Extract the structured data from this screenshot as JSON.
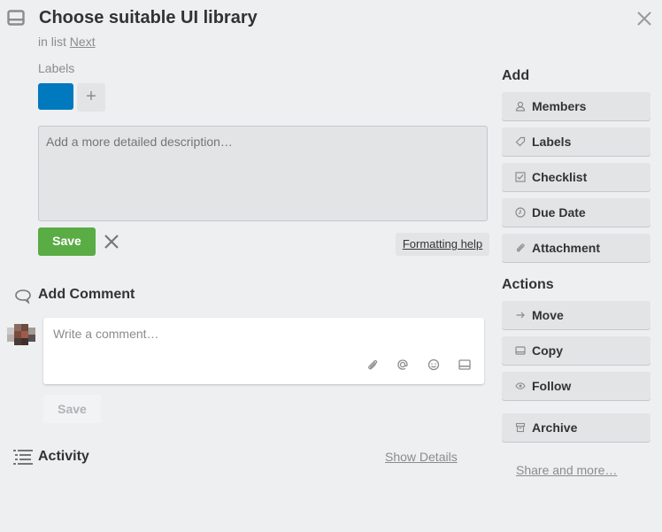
{
  "card": {
    "title": "Choose suitable UI library",
    "in_list_prefix": "in list",
    "list_name": "Next"
  },
  "labels": {
    "heading": "Labels",
    "items": [
      {
        "color": "#0079bf"
      }
    ],
    "add_symbol": "+"
  },
  "description": {
    "placeholder": "Add a more detailed description…",
    "save_label": "Save",
    "formatting_help": "Formatting help"
  },
  "comment": {
    "heading": "Add Comment",
    "placeholder": "Write a comment…",
    "save_label": "Save",
    "tools": [
      "attachment-icon",
      "mention-icon",
      "emoji-icon",
      "card-icon"
    ]
  },
  "activity": {
    "heading": "Activity",
    "show_details": "Show Details"
  },
  "sidebar": {
    "add_heading": "Add",
    "add_items": [
      {
        "label": "Members",
        "icon": "person-icon"
      },
      {
        "label": "Labels",
        "icon": "tag-icon"
      },
      {
        "label": "Checklist",
        "icon": "checkbox-icon"
      },
      {
        "label": "Due Date",
        "icon": "clock-icon"
      },
      {
        "label": "Attachment",
        "icon": "paperclip-icon"
      }
    ],
    "actions_heading": "Actions",
    "action_items": [
      {
        "label": "Move",
        "icon": "arrow-right-icon"
      },
      {
        "label": "Copy",
        "icon": "card-icon"
      },
      {
        "label": "Follow",
        "icon": "eye-icon"
      },
      {
        "label": "Archive",
        "icon": "archive-icon"
      }
    ],
    "share_label": "Share and more…"
  },
  "colors": {
    "save_green": "#5aac44",
    "label_blue": "#0079bf",
    "background": "#edeff0"
  }
}
